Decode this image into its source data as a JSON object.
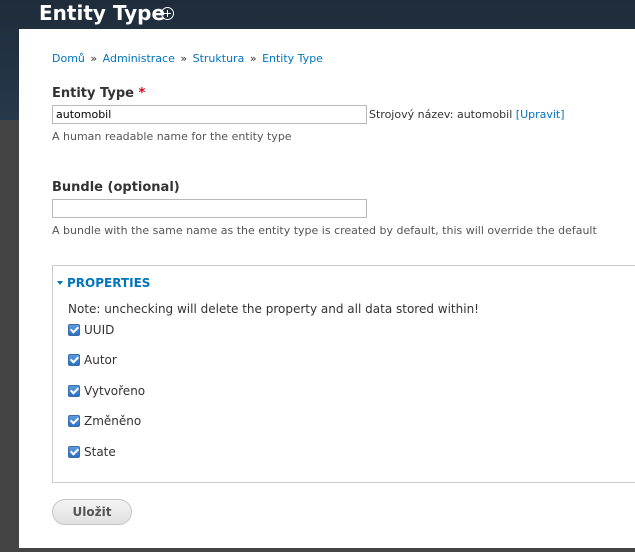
{
  "header": {
    "title": "Entity Type",
    "add_shortcut_icon": "plus-circle-icon"
  },
  "breadcrumb": {
    "items": [
      "Domů",
      "Administrace",
      "Struktura",
      "Entity Type"
    ],
    "separator": "»"
  },
  "entity_type": {
    "label": "Entity Type",
    "required_marker": "*",
    "value": "automobil",
    "machine_name_prefix": "Strojový název: automobil",
    "machine_name_edit": "[Upravit]",
    "description": "A human readable name for the entity type"
  },
  "bundle": {
    "label": "Bundle (optional)",
    "value": "",
    "description": "A bundle with the same name as the entity type is created by default, this will override the default"
  },
  "properties": {
    "legend": "PROPERTIES",
    "note": "Note: unchecking will delete the property and all data stored within!",
    "items": [
      {
        "label": "UUID",
        "checked": true
      },
      {
        "label": "Autor",
        "checked": true
      },
      {
        "label": "Vytvořeno",
        "checked": true
      },
      {
        "label": "Změněno",
        "checked": true
      },
      {
        "label": "State",
        "checked": true
      }
    ]
  },
  "actions": {
    "save_label": "Uložit"
  },
  "colors": {
    "link": "#0074bd",
    "header_bg": "#1f2c3a",
    "required": "#e0001a",
    "checkbox": "#2d6fc4"
  }
}
